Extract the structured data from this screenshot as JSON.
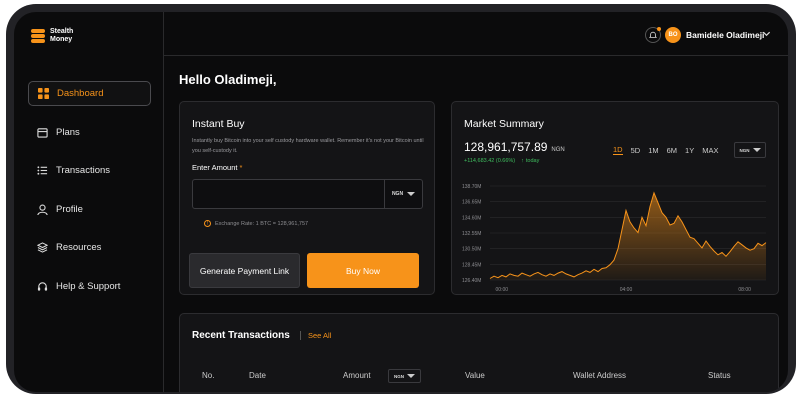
{
  "brand": {
    "line1": "Stealth",
    "line2": "Money"
  },
  "sidebar": {
    "items": [
      {
        "label": "Dashboard",
        "icon": "grid-icon",
        "active": true
      },
      {
        "label": "Plans",
        "icon": "calendar-icon",
        "active": false
      },
      {
        "label": "Transactions",
        "icon": "list-icon",
        "active": false
      },
      {
        "label": "Profile",
        "icon": "user-icon",
        "active": false
      },
      {
        "label": "Resources",
        "icon": "layers-icon",
        "active": false
      },
      {
        "label": "Help & Support",
        "icon": "headset-icon",
        "active": false
      }
    ]
  },
  "topbar": {
    "avatar_initials": "BO",
    "user_name": "Bamidele Oladimeji"
  },
  "greeting": "Hello Oladimeji,",
  "instant_buy": {
    "title": "Instant Buy",
    "description": "Instantly buy Bitcoin into your self custody hardware wallet. Remember it's not your Bitcoin until you self-custody it.",
    "amount_label": "Enter Amount",
    "required_mark": "*",
    "amount_value": "",
    "currency": "NGN",
    "exchange_rate": "Exchange Rate: 1 BTC = 128,961,757",
    "generate_label": "Generate Payment Link",
    "buy_label": "Buy Now"
  },
  "market": {
    "title": "Market Summary",
    "price": "128,961,757.89",
    "currency": "NGN",
    "change": "+114,683.42 (0.66%)",
    "change_period": "today",
    "ranges": [
      "1D",
      "5D",
      "1M",
      "6M",
      "1Y",
      "MAX"
    ],
    "active_range": "1D",
    "select_currency": "NGN"
  },
  "chart_data": {
    "type": "area",
    "y_ticks": [
      "138.70M",
      "136.65M",
      "134.60M",
      "132.55M",
      "130.50M",
      "128.45M",
      "126.40M"
    ],
    "x_ticks": [
      "00:00",
      "04:00",
      "08:00"
    ],
    "ylim": [
      126.4,
      138.7
    ],
    "values": [
      126.6,
      126.9,
      126.7,
      127.0,
      126.8,
      127.2,
      127.0,
      126.9,
      127.3,
      127.1,
      126.9,
      127.2,
      127.4,
      127.1,
      126.9,
      127.2,
      127.0,
      127.3,
      127.5,
      127.2,
      127.0,
      126.8,
      127.1,
      127.3,
      127.6,
      127.4,
      127.8,
      127.5,
      127.9,
      128.0,
      128.4,
      129.0,
      130.5,
      133.0,
      135.5,
      134.0,
      133.2,
      132.6,
      134.6,
      133.5,
      136.0,
      137.8,
      136.5,
      135.2,
      134.6,
      133.6,
      133.8,
      134.8,
      134.0,
      133.0,
      132.0,
      131.8,
      131.2,
      130.6,
      131.5,
      130.8,
      130.2,
      129.7,
      130.0,
      129.5,
      130.1,
      130.8,
      131.4,
      131.0,
      130.6,
      130.3,
      130.5,
      131.2,
      130.9,
      131.3
    ],
    "series_color": "#f7931a",
    "grid": true
  },
  "recent": {
    "title": "Recent Transactions",
    "see_all": "See All",
    "columns": [
      "No.",
      "Date",
      "Amount",
      "Value",
      "Wallet Address",
      "Status"
    ],
    "amount_currency": "NGN"
  }
}
